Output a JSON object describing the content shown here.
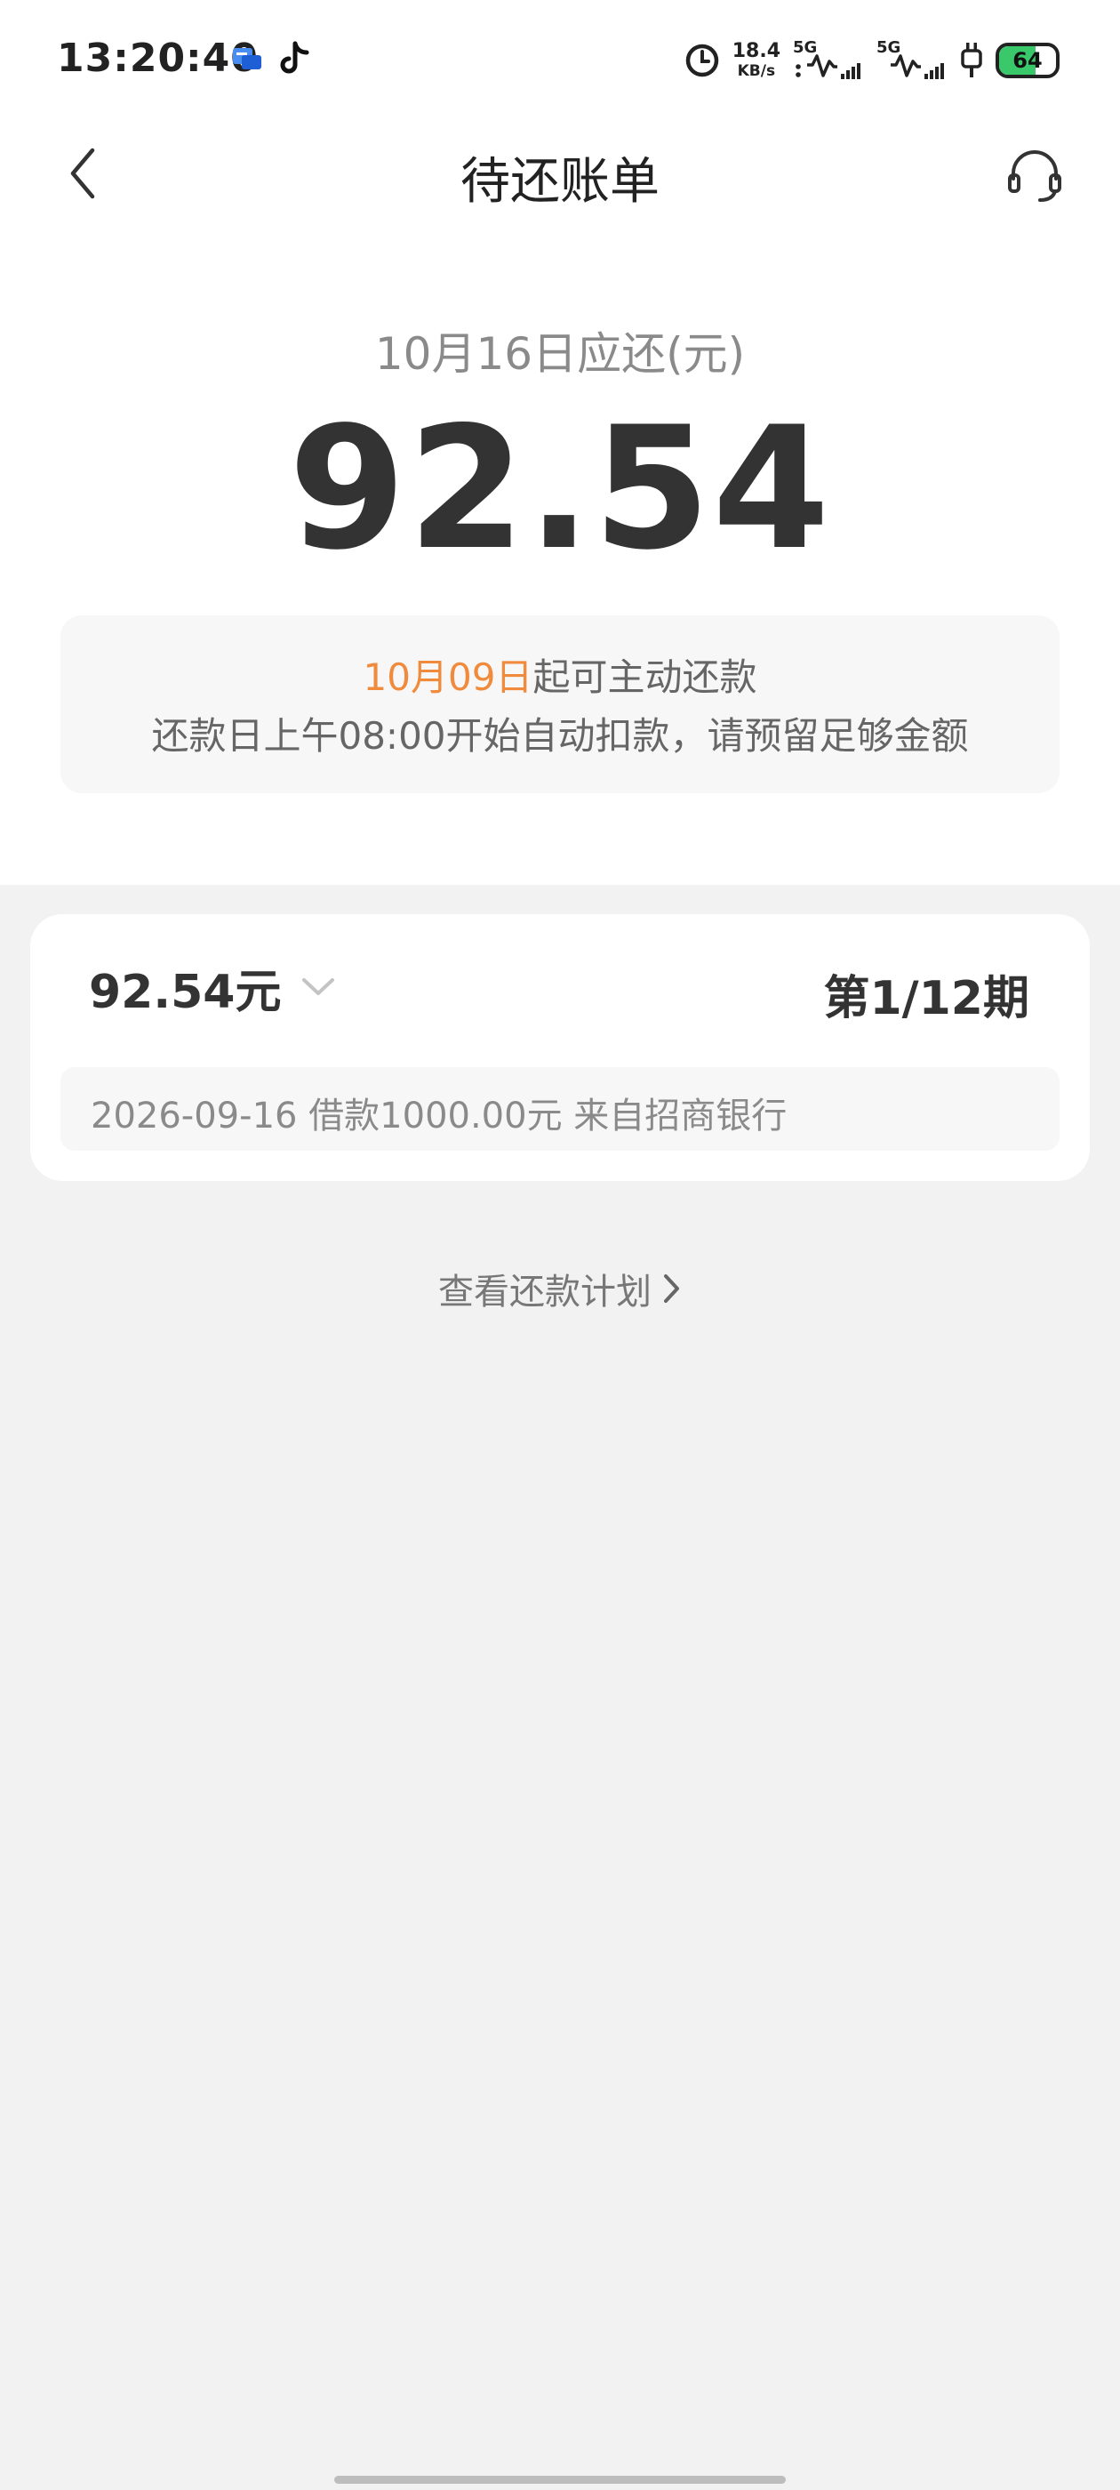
{
  "status_bar": {
    "time": "13:20:40",
    "notification_icons": [
      "chat-app-icon",
      "tiktok-icon"
    ],
    "network_speed_value": "18.4",
    "network_speed_unit": "KB/s",
    "signal_1_label": "5G",
    "signal_2_label": "5G",
    "battery_level": "64",
    "battery_color": "#39c86a",
    "icons": [
      "alarm-icon",
      "signal-icon",
      "charging-icon",
      "battery-icon"
    ]
  },
  "nav": {
    "title": "待还账单",
    "back_icon": "chevron-left-icon",
    "service_icon": "headset-icon"
  },
  "summary": {
    "due_label": "10月16日应还(元)",
    "due_amount": "92.54"
  },
  "notice": {
    "start_date": "10月09日",
    "line1_suffix": "起可主动还款",
    "line2": "还款日上午08:00开始自动扣款，请预留足够金额",
    "highlight_color": "#f08a3c"
  },
  "bill": {
    "amount": "92.54元",
    "period": "第1/12期",
    "loan_info": "2026-09-16 借款1000.00元 来自招商银行"
  },
  "plan_link": {
    "label": "查看还款计划"
  }
}
